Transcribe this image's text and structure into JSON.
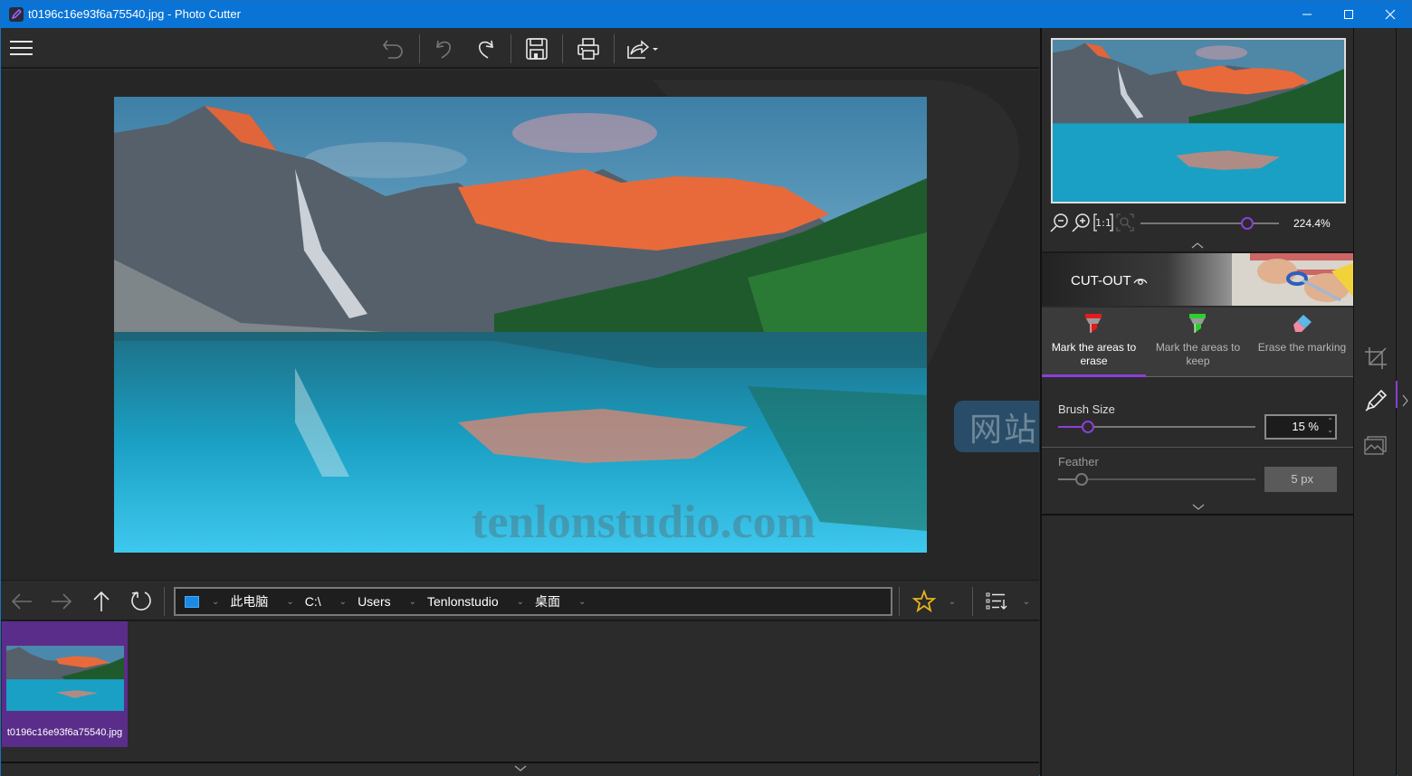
{
  "window": {
    "title": "t0196c16e93f6a75540.jpg - Photo Cutter",
    "controls": [
      "minimize",
      "maximize",
      "close"
    ]
  },
  "toolbar": {
    "menu_icon": "hamburger-icon",
    "buttons": [
      {
        "name": "undo-all",
        "icon": "undo-arrow-icon",
        "enabled": false
      },
      {
        "name": "undo",
        "icon": "undo-icon",
        "enabled": false
      },
      {
        "name": "redo",
        "icon": "redo-icon",
        "enabled": true
      },
      {
        "name": "save",
        "icon": "floppy-disk-icon",
        "enabled": true
      },
      {
        "name": "print",
        "icon": "printer-icon",
        "enabled": true
      },
      {
        "name": "share",
        "icon": "share-icon",
        "enabled": true,
        "has_dropdown": true
      }
    ]
  },
  "canvas": {
    "watermark_cn": "网站",
    "watermark_en": "tenlonstudio.com"
  },
  "navigator": {
    "buttons": [
      "back",
      "forward",
      "up",
      "refresh"
    ],
    "path": [
      "此电脑",
      "C:\\",
      "Users",
      "Tenlonstudio",
      "桌面"
    ],
    "favorites_icon": "star-icon",
    "view_icon": "list-sort-icon"
  },
  "filmstrip": {
    "items": [
      {
        "filename": "t0196c16e93f6a75540.jpg",
        "selected": true
      }
    ]
  },
  "panel": {
    "zoom": {
      "value_label": "224.4%",
      "slider_fraction": 0.77
    },
    "mode": {
      "title": "CUT-OUT",
      "tools": [
        {
          "label": "Mark the areas to erase",
          "icon": "red-marker-icon",
          "active": true
        },
        {
          "label": "Mark the areas to keep",
          "icon": "green-marker-icon",
          "active": false
        },
        {
          "label": "Erase the marking",
          "icon": "eraser-icon",
          "active": false
        }
      ]
    },
    "brush_size": {
      "label": "Brush Size",
      "value": "15 %",
      "fraction": 0.15
    },
    "feather": {
      "label": "Feather",
      "value": "5 px",
      "fraction": 0.12,
      "enabled": false
    }
  },
  "rail": {
    "items": [
      {
        "name": "crop",
        "icon": "crop-icon",
        "active": false
      },
      {
        "name": "cutout",
        "icon": "pencil-icon",
        "active": true
      },
      {
        "name": "background",
        "icon": "image-icon",
        "active": false
      }
    ]
  },
  "colors": {
    "accent": "#8b3fd8",
    "titlebar": "#0a74d6",
    "background": "#2b2b2b",
    "thumb_selected": "#5b2d8a",
    "star": "#e8b31e"
  }
}
